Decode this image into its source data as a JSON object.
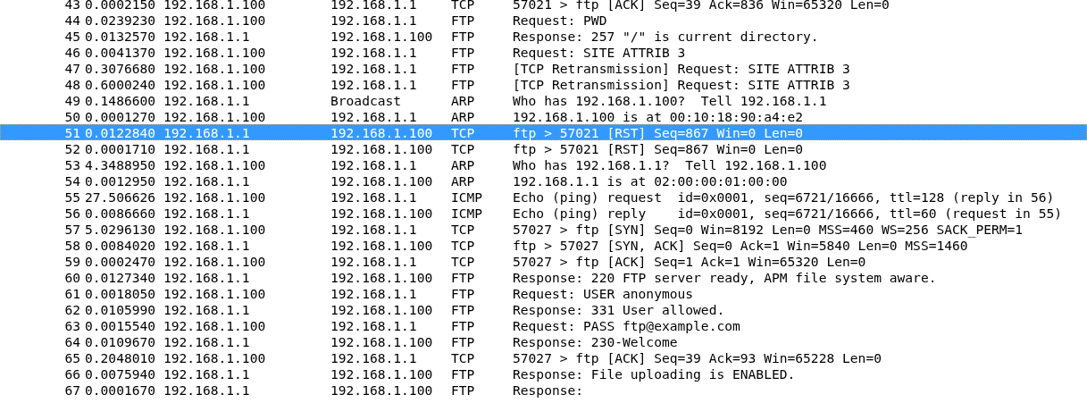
{
  "packets": [
    {
      "no": "43",
      "time": "0.0002150",
      "source": "192.168.1.100",
      "destination": "192.168.1.1",
      "protocol": "TCP",
      "info": "57021 > ftp [ACK] Seq=39 Ack=836 Win=65320 Len=0",
      "selected": false
    },
    {
      "no": "44",
      "time": "0.0239230",
      "source": "192.168.1.100",
      "destination": "192.168.1.1",
      "protocol": "FTP",
      "info": "Request: PWD",
      "selected": false
    },
    {
      "no": "45",
      "time": "0.0132570",
      "source": "192.168.1.1",
      "destination": "192.168.1.100",
      "protocol": "FTP",
      "info": "Response: 257 \"/\" is current directory.",
      "selected": false
    },
    {
      "no": "46",
      "time": "0.0041370",
      "source": "192.168.1.100",
      "destination": "192.168.1.1",
      "protocol": "FTP",
      "info": "Request: SITE ATTRIB 3",
      "selected": false
    },
    {
      "no": "47",
      "time": "0.3076680",
      "source": "192.168.1.100",
      "destination": "192.168.1.1",
      "protocol": "FTP",
      "info": "[TCP Retransmission] Request: SITE ATTRIB 3",
      "selected": false
    },
    {
      "no": "48",
      "time": "0.6000240",
      "source": "192.168.1.100",
      "destination": "192.168.1.1",
      "protocol": "FTP",
      "info": "[TCP Retransmission] Request: SITE ATTRIB 3",
      "selected": false
    },
    {
      "no": "49",
      "time": "0.1486600",
      "source": "192.168.1.1",
      "destination": "Broadcast",
      "protocol": "ARP",
      "info": "Who has 192.168.1.100?  Tell 192.168.1.1",
      "selected": false
    },
    {
      "no": "50",
      "time": "0.0001270",
      "source": "192.168.1.100",
      "destination": "192.168.1.1",
      "protocol": "ARP",
      "info": "192.168.1.100 is at 00:10:18:90:a4:e2",
      "selected": false
    },
    {
      "no": "51",
      "time": "0.0122840",
      "source": "192.168.1.1",
      "destination": "192.168.1.100",
      "protocol": "TCP",
      "info": "ftp > 57021 [RST] Seq=867 Win=0 Len=0",
      "selected": true
    },
    {
      "no": "52",
      "time": "0.0001710",
      "source": "192.168.1.1",
      "destination": "192.168.1.100",
      "protocol": "TCP",
      "info": "ftp > 57021 [RST] Seq=867 Win=0 Len=0",
      "selected": false
    },
    {
      "no": "53",
      "time": "4.3488950",
      "source": "192.168.1.100",
      "destination": "192.168.1.1",
      "protocol": "ARP",
      "info": "Who has 192.168.1.1?  Tell 192.168.1.100",
      "selected": false
    },
    {
      "no": "54",
      "time": "0.0012950",
      "source": "192.168.1.1",
      "destination": "192.168.1.100",
      "protocol": "ARP",
      "info": "192.168.1.1 is at 02:00:00:01:00:00",
      "selected": false
    },
    {
      "no": "55",
      "time": "27.506626",
      "source": "192.168.1.100",
      "destination": "192.168.1.1",
      "protocol": "ICMP",
      "info": "Echo (ping) request  id=0x0001, seq=6721/16666, ttl=128 (reply in 56)",
      "selected": false
    },
    {
      "no": "56",
      "time": "0.0086660",
      "source": "192.168.1.1",
      "destination": "192.168.1.100",
      "protocol": "ICMP",
      "info": "Echo (ping) reply    id=0x0001, seq=6721/16666, ttl=60 (request in 55)",
      "selected": false
    },
    {
      "no": "57",
      "time": "5.0296130",
      "source": "192.168.1.100",
      "destination": "192.168.1.1",
      "protocol": "TCP",
      "info": "57027 > ftp [SYN] Seq=0 Win=8192 Len=0 MSS=460 WS=256 SACK_PERM=1",
      "selected": false
    },
    {
      "no": "58",
      "time": "0.0084020",
      "source": "192.168.1.1",
      "destination": "192.168.1.100",
      "protocol": "TCP",
      "info": "ftp > 57027 [SYN, ACK] Seq=0 Ack=1 Win=5840 Len=0 MSS=1460",
      "selected": false
    },
    {
      "no": "59",
      "time": "0.0002470",
      "source": "192.168.1.100",
      "destination": "192.168.1.1",
      "protocol": "TCP",
      "info": "57027 > ftp [ACK] Seq=1 Ack=1 Win=65320 Len=0",
      "selected": false
    },
    {
      "no": "60",
      "time": "0.0127340",
      "source": "192.168.1.1",
      "destination": "192.168.1.100",
      "protocol": "FTP",
      "info": "Response: 220 FTP server ready, APM file system aware.",
      "selected": false
    },
    {
      "no": "61",
      "time": "0.0018050",
      "source": "192.168.1.100",
      "destination": "192.168.1.1",
      "protocol": "FTP",
      "info": "Request: USER anonymous",
      "selected": false
    },
    {
      "no": "62",
      "time": "0.0105990",
      "source": "192.168.1.1",
      "destination": "192.168.1.100",
      "protocol": "FTP",
      "info": "Response: 331 User allowed.",
      "selected": false
    },
    {
      "no": "63",
      "time": "0.0015540",
      "source": "192.168.1.100",
      "destination": "192.168.1.1",
      "protocol": "FTP",
      "info": "Request: PASS ftp@example.com",
      "selected": false
    },
    {
      "no": "64",
      "time": "0.0109670",
      "source": "192.168.1.1",
      "destination": "192.168.1.100",
      "protocol": "FTP",
      "info": "Response: 230-Welcome",
      "selected": false
    },
    {
      "no": "65",
      "time": "0.2048010",
      "source": "192.168.1.100",
      "destination": "192.168.1.1",
      "protocol": "TCP",
      "info": "57027 > ftp [ACK] Seq=39 Ack=93 Win=65228 Len=0",
      "selected": false
    },
    {
      "no": "66",
      "time": "0.0075940",
      "source": "192.168.1.1",
      "destination": "192.168.1.100",
      "protocol": "FTP",
      "info": "Response: File uploading is ENABLED.",
      "selected": false
    },
    {
      "no": "67",
      "time": "0.0001670",
      "source": "192.168.1.1",
      "destination": "192.168.1.100",
      "protocol": "FTP",
      "info": "Response:",
      "selected": false
    }
  ]
}
